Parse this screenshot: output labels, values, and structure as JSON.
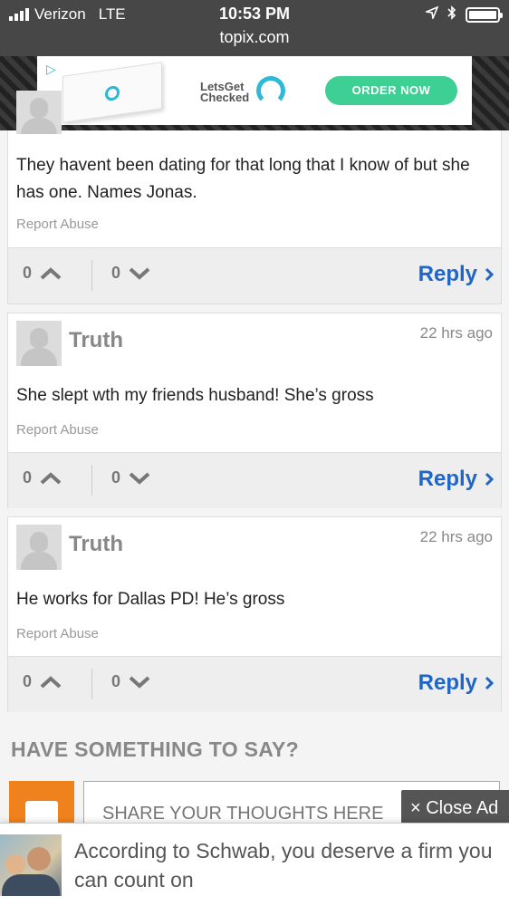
{
  "status_bar": {
    "carrier": "Verizon",
    "network": "LTE",
    "time": "10:53 PM",
    "url": "topix.com"
  },
  "top_ad": {
    "brand": "LetsGet Checked",
    "cta": "ORDER NOW",
    "colors": {
      "accent": "#2fb8d8",
      "button": "#3dcf93"
    }
  },
  "comments": [
    {
      "text": "They havent been dating for that long that I know of but she has one. Names Jonas.",
      "report": "Report Abuse",
      "upvotes": "0",
      "downvotes": "0",
      "reply": "Reply"
    },
    {
      "author": "Truth",
      "time": "22 hrs ago",
      "text": "She slept wth my friends husband! She’s gross",
      "report": "Report Abuse",
      "upvotes": "0",
      "downvotes": "0",
      "reply": "Reply"
    },
    {
      "author": "Truth",
      "time": "22 hrs ago",
      "text": "He works for Dallas PD! He’s gross",
      "report": "Report Abuse",
      "upvotes": "0",
      "downvotes": "0",
      "reply": "Reply"
    }
  ],
  "compose": {
    "heading": "HAVE SOMETHING TO SAY?",
    "placeholder": "SHARE YOUR THOUGHTS HERE"
  },
  "bottom_ad": {
    "close_label": "× Close Ad",
    "headline": "According to Schwab, you deserve a firm you can count on"
  },
  "colors": {
    "reply_link": "#1f66c8",
    "avatar_badge": "#f0821e"
  }
}
